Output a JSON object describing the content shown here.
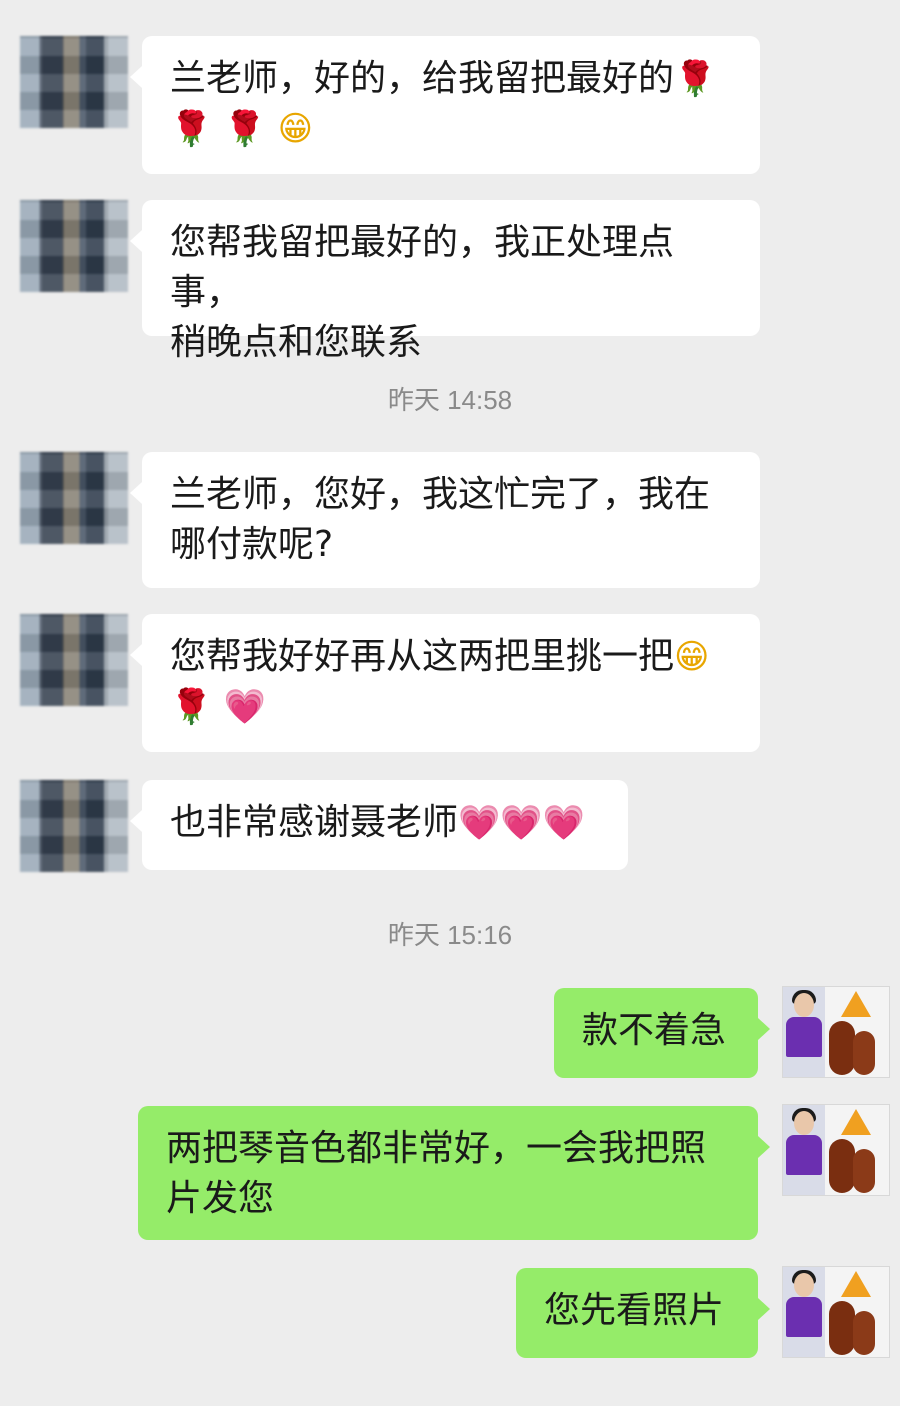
{
  "messages": [
    {
      "side": "in",
      "text": "兰老师，好的，给我留把最好的🌹🌹🌹😁"
    },
    {
      "side": "in",
      "text": "您帮我留把最好的，我正处理点事，稍晚点和您联系"
    },
    {
      "side": "time",
      "text": "昨天 14:58"
    },
    {
      "side": "in",
      "text": "兰老师，您好，我这忙完了，我在哪付款呢?"
    },
    {
      "side": "in",
      "text": "您帮我好好再从这两把里挑一把😁🌹💗"
    },
    {
      "side": "in",
      "text": "也非常感谢聂老师💗💗💗"
    },
    {
      "side": "time",
      "text": "昨天 15:16"
    },
    {
      "side": "out",
      "text": "款不着急"
    },
    {
      "side": "out",
      "text": "两把琴音色都非常好，一会我把照片发您"
    },
    {
      "side": "out",
      "text": "您先看照片"
    }
  ],
  "bubbles": {
    "m1_line1": "兰老师，好的，给我留把最好的",
    "m1_line2": "",
    "m2_line1": "您帮我留把最好的，我正处理点事，",
    "m2_line2": "稍晚点和您联系",
    "m3_line1": "兰老师，您好，我这忙完了，我在",
    "m3_line2": "哪付款呢?",
    "m4_line1": "您帮我好好再从这两把里挑一把",
    "m5_line1": "也非常感谢聂老师",
    "o1": "款不着急",
    "o2_line1": "两把琴音色都非常好，一会我把照",
    "o2_line2": "片发您",
    "o3": "您先看照片"
  },
  "timestamps": {
    "t1": "昨天 14:58",
    "t2": "昨天 15:16"
  },
  "emoji": {
    "rose": "🌹",
    "grin": "😁",
    "heart": "💗"
  },
  "colors": {
    "background": "#ededed",
    "incoming_bubble": "#ffffff",
    "outgoing_bubble": "#95ec69",
    "timestamp": "#8a8a8a"
  }
}
